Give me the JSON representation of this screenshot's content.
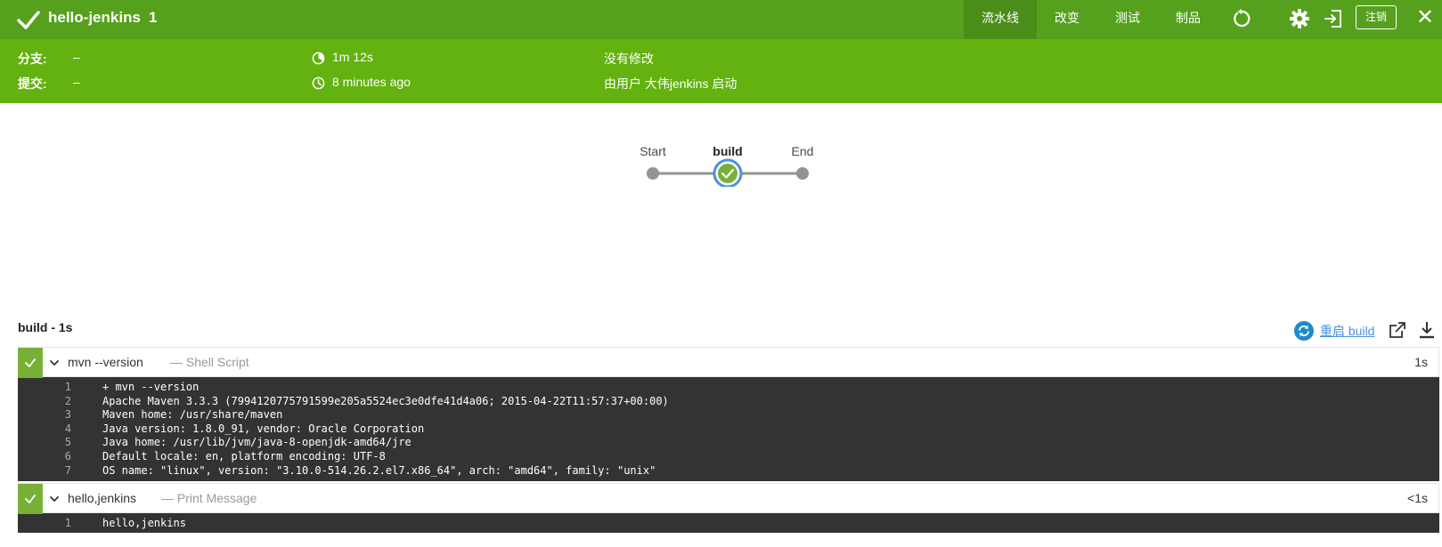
{
  "topbar": {
    "title": "hello-jenkins",
    "run_number": "1",
    "tabs": [
      "流水线",
      "改变",
      "测试",
      "制品"
    ],
    "logout_label": "注销",
    "close_glyph": "✕"
  },
  "summary": {
    "branch_label": "分支:",
    "branch_value": "–",
    "commit_label": "提交:",
    "commit_value": "–",
    "duration": "1m 12s",
    "started": "8 minutes ago",
    "changes": "没有修改",
    "started_by": "由用户 大伟jenkins 启动"
  },
  "pipeline": {
    "stages": [
      "Start",
      "build",
      "End"
    ],
    "selected": "build"
  },
  "log_header": {
    "title": "build - 1s",
    "restart_label": "重启 build"
  },
  "steps": [
    {
      "name": "mvn --version",
      "type": "— Shell Script",
      "duration": "1s",
      "lines": [
        "+ mvn --version",
        "Apache Maven 3.3.3 (7994120775791599e205a5524ec3e0dfe41d4a06; 2015-04-22T11:57:37+00:00)",
        "Maven home: /usr/share/maven",
        "Java version: 1.8.0_91, vendor: Oracle Corporation",
        "Java home: /usr/lib/jvm/java-8-openjdk-amd64/jre",
        "Default locale: en, platform encoding: UTF-8",
        "OS name: \"linux\", version: \"3.10.0-514.26.2.el7.x86_64\", arch: \"amd64\", family: \"unix\""
      ],
      "line_numbers": [
        "1",
        "2",
        "3",
        "4",
        "5",
        "6",
        "7"
      ]
    },
    {
      "name": "hello,jenkins",
      "type": "— Print Message",
      "duration": "<1s",
      "lines": [
        "hello,jenkins"
      ],
      "line_numbers": [
        "1"
      ]
    }
  ],
  "colors": {
    "topbar": "#55a11d",
    "summary": "#63b20f",
    "success": "#78b037",
    "selected_ring": "#4a90e2",
    "log_bg": "#333333"
  },
  "icons": {
    "success": "check-icon",
    "replay": "replay-icon",
    "settings": "gear-icon",
    "exit": "exit-icon",
    "duration": "timer-icon",
    "time": "clock-icon",
    "restart": "refresh-icon",
    "open": "open-external-icon",
    "download": "download-icon",
    "expand": "chevron-down-icon"
  }
}
